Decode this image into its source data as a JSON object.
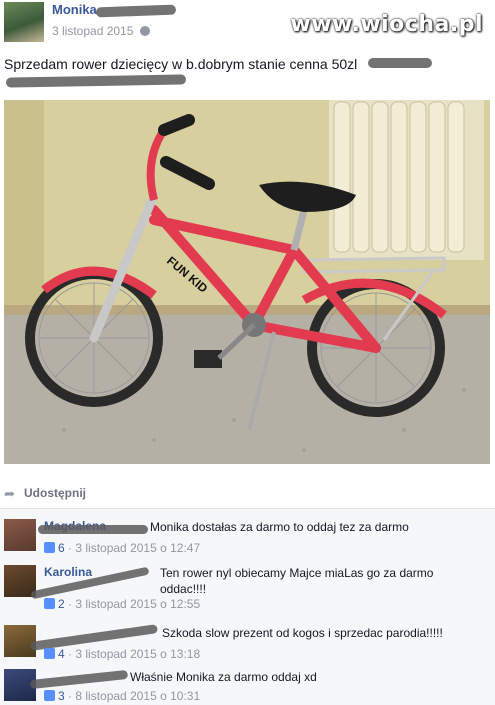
{
  "post": {
    "author": "Monika",
    "date": "3 listopad 2015",
    "text": "Sprzedam rower dziecięcy w b.dobrym stanie cenna 50zl",
    "watermark": "www.wiocha.pl",
    "photo_label": "FUN KID"
  },
  "actions": {
    "share": "Udostępnij"
  },
  "comments": [
    {
      "author": "Magdalena",
      "text": "Monika dostałas za darmo to oddaj tez za darmo",
      "likes": "6",
      "time": "· 3 listopad 2015 o 12:47"
    },
    {
      "author": "Karolina",
      "text": "Ten rower nyl obiecamy Majce miaLas go za darmo oddac!!!!",
      "likes": "2",
      "time": "· 3 listopad 2015 o 12:55"
    },
    {
      "author": "",
      "text": "Szkoda slow prezent od kogos i sprzedac parodia!!!!!",
      "likes": "4",
      "time": "· 3 listopad 2015 o 13:18"
    },
    {
      "author": "",
      "text": "Właśnie Monika za darmo oddaj xd",
      "likes": "3",
      "time": "· 8 listopad 2015 o 10:31"
    }
  ]
}
